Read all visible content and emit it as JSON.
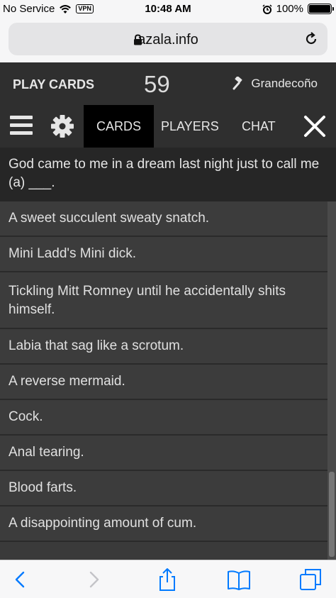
{
  "status_bar": {
    "carrier": "No Service",
    "vpn": "VPN",
    "time": "10:48 AM",
    "battery": "100%"
  },
  "browser": {
    "host": "azala.info"
  },
  "app": {
    "title": "PLAY CARDS",
    "score": "59",
    "user": "Grandecoño"
  },
  "nav": {
    "tabs": [
      "CARDS",
      "PLAYERS",
      "CHAT"
    ],
    "active_tab": "CARDS"
  },
  "prompt": "God came to me in a dream last night just to call me (a) ___.",
  "cards": [
    "A sweet succulent sweaty snatch.",
    "Mini Ladd's Mini dick.",
    "Tickling Mitt Romney until he accidentally shits himself.",
    "Labia that sag like a scrotum.",
    "A reverse mermaid.",
    "Cock.",
    "Anal tearing.",
    "Blood farts.",
    "A disappointing amount of cum."
  ],
  "colors": {
    "accent": "#007aff",
    "header_bg": "#2f2f2f",
    "card_bg": "#3c3c3c"
  }
}
